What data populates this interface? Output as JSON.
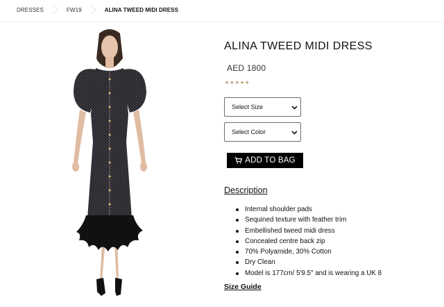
{
  "breadcrumb": {
    "items": [
      "DRESSES",
      "FW19",
      "ALINA TWEED MIDI DRESS"
    ]
  },
  "product": {
    "title": "ALINA TWEED MIDI DRESS",
    "price": "AED 1800",
    "rating_stars": 5,
    "rating_glyph": "★",
    "star_color": "#b79a6d",
    "image_alt": "model wearing dark tweed puff-sleeve midi dress with feather hem"
  },
  "options": {
    "size_select": {
      "selected": "Select Size"
    },
    "color_select": {
      "selected": "Select Color"
    }
  },
  "actions": {
    "add_to_bag_label": "ADD TO BAG",
    "add_to_bag_icon": "cart-icon"
  },
  "description": {
    "heading": "Description",
    "bullets": [
      "Internal shoulder pads",
      "Sequined texture with feather trim",
      "Embellished tweed midi dress",
      "Concealed centre back zip",
      "70% Polyamide, 30% Cotton",
      "Dry Clean",
      "Model is 177cm/ 5'9.5\" and is wearing a UK 8"
    ]
  },
  "links": {
    "size_guide": "Size Guide"
  }
}
